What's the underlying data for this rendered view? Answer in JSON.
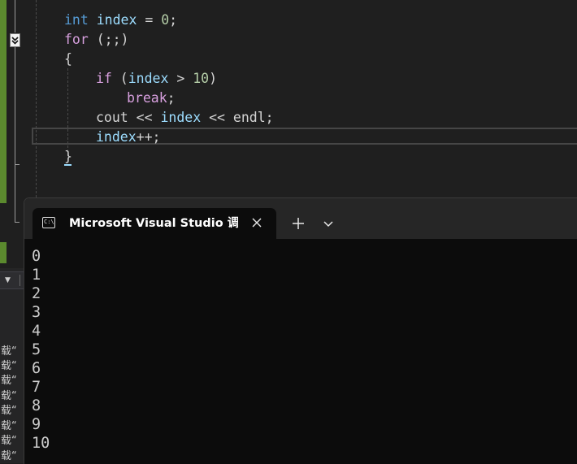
{
  "editor": {
    "lines": {
      "l1": {
        "t1": "int",
        "t2": " ",
        "t3": "index",
        "t4": " = ",
        "t5": "0",
        "t6": ";"
      },
      "l2": {
        "t1": "for",
        "t2": " (;;)"
      },
      "l3": {
        "t1": "{"
      },
      "l4": {
        "t1": "if",
        "t2": " (",
        "t3": "index",
        "t4": " > ",
        "t5": "10",
        "t6": ")"
      },
      "l5": {
        "t1": "break",
        "t2": ";"
      },
      "l6": {
        "t1": "cout",
        "t2": " << ",
        "t3": "index",
        "t4": " << ",
        "t5": "endl",
        "t6": ";"
      },
      "l7": {
        "t1": "index",
        "t2": "++;"
      },
      "l8": {
        "t1": "}"
      }
    },
    "fold_icon": "collapse-chevron-icon"
  },
  "output_panel": {
    "dropdown_icon": "dropdown-arrow-icon",
    "lines": [
      "载“",
      "载“",
      "载“",
      "载“",
      "载“",
      "载“",
      "载“",
      "载“"
    ]
  },
  "terminal": {
    "tab": {
      "icon": "console-icon",
      "icon_text": "C:\\",
      "title": "Microsoft Visual Studio 调试控制台",
      "close_icon": "close-icon"
    },
    "new_tab_icon": "plus-icon",
    "dropdown_icon": "chevron-down-icon",
    "output": [
      "0",
      "1",
      "2",
      "3",
      "4",
      "5",
      "6",
      "7",
      "8",
      "9",
      "10"
    ]
  },
  "colors": {
    "keyword": "#569cd6",
    "control_keyword": "#d8a0df",
    "variable": "#9cdcfe",
    "number": "#b5cea8",
    "function": "#dcdcaa",
    "change_bar": "#5b8a2e",
    "terminal_bg": "#0c0c0c",
    "tabbar_bg": "#262626"
  }
}
